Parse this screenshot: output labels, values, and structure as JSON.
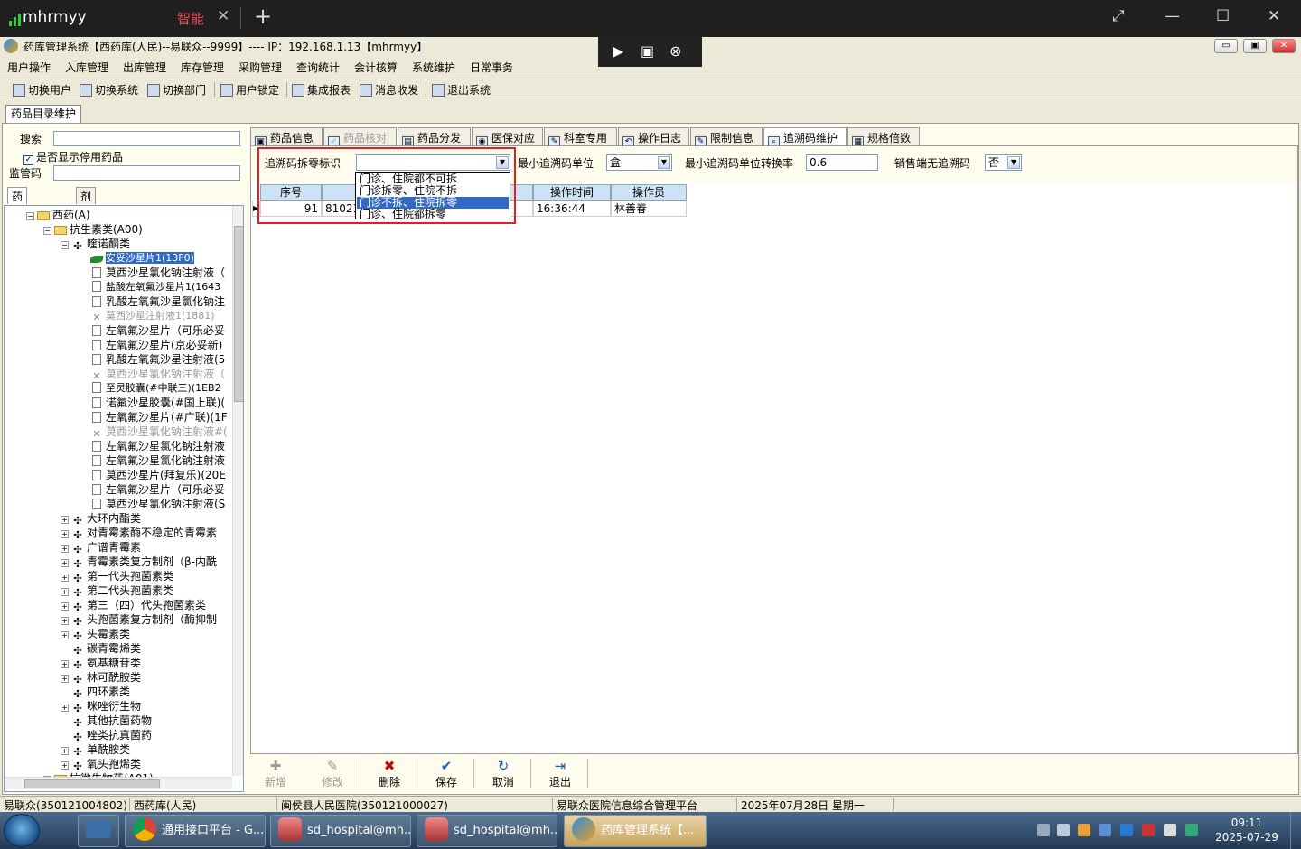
{
  "remote": {
    "brand": "mhrmyy",
    "tab_label": "智能",
    "close_glyph": "✕",
    "plus_glyph": "+",
    "ctrl": [
      "▶",
      "▣",
      "⊗"
    ]
  },
  "window": {
    "title": "药库管理系统【西药库(人民)--易联众--9999】---- IP：192.168.1.13【mhrmyy】",
    "min": "▭",
    "max": "▣",
    "close": "✕"
  },
  "menu": [
    "用户操作",
    "入库管理",
    "出库管理",
    "库存管理",
    "采购管理",
    "查询统计",
    "会计核算",
    "系统维护",
    "日常事务"
  ],
  "toolbar": [
    "切换用户",
    "切换系统",
    "切换部门",
    "用户锁定",
    "集成报表",
    "消息收发",
    "退出系统"
  ],
  "doc_tab": "药品目录维护",
  "left": {
    "search_label": "搜索",
    "show_disabled_label": "是否显示停用药品",
    "show_disabled_check": "✓",
    "supervision_label": "监管码",
    "tabs": [
      "药理结构树",
      "剂型结构树"
    ],
    "tree": [
      {
        "text": "西药(A)",
        "level": 0,
        "exp": "⊟",
        "icon": "folder"
      },
      {
        "text": "抗生素类(A00)",
        "level": 1,
        "exp": "⊟",
        "icon": "folder"
      },
      {
        "text": "喹诺酮类",
        "level": 2,
        "exp": "⊟",
        "icon": "group"
      },
      {
        "text": "安妥沙星片1(13F0)",
        "level": 3,
        "icon": "leaf",
        "selected": true,
        "small": true
      },
      {
        "text": "莫西沙星氯化钠注射液（",
        "level": 3,
        "icon": "file"
      },
      {
        "text": "盐酸左氧氟沙星片1(1643",
        "level": 3,
        "icon": "file",
        "small": true
      },
      {
        "text": "乳酸左氧氟沙星氯化钠注",
        "level": 3,
        "icon": "file"
      },
      {
        "text": "莫西沙星注射液1(1881)",
        "level": 3,
        "icon": "x",
        "disabled": true,
        "small": true
      },
      {
        "text": "左氧氟沙星片（可乐必妥",
        "level": 3,
        "icon": "file"
      },
      {
        "text": "左氧氟沙星片(京必妥新)",
        "level": 3,
        "icon": "file"
      },
      {
        "text": "乳酸左氧氟沙星注射液(5",
        "level": 3,
        "icon": "file"
      },
      {
        "text": "莫西沙星氯化钠注射液（",
        "level": 3,
        "icon": "x",
        "disabled": true
      },
      {
        "text": "至灵胶囊(#中联三)(1EB2",
        "level": 3,
        "icon": "file",
        "small": true
      },
      {
        "text": "诺氟沙星胶囊(#国上联)(",
        "level": 3,
        "icon": "file"
      },
      {
        "text": "左氧氟沙星片(#广联)(1F",
        "level": 3,
        "icon": "file"
      },
      {
        "text": "莫西沙星氯化钠注射液#(",
        "level": 3,
        "icon": "x",
        "disabled": true
      },
      {
        "text": "左氧氟沙星氯化钠注射液",
        "level": 3,
        "icon": "file"
      },
      {
        "text": "左氧氟沙星氯化钠注射液",
        "level": 3,
        "icon": "file"
      },
      {
        "text": "莫西沙星片(拜复乐)(20E",
        "level": 3,
        "icon": "file"
      },
      {
        "text": "左氧氟沙星片（可乐必妥",
        "level": 3,
        "icon": "file"
      },
      {
        "text": "莫西沙星氯化钠注射液(S",
        "level": 3,
        "icon": "file"
      },
      {
        "text": "大环内酯类",
        "level": 2,
        "exp": "⊞",
        "icon": "group"
      },
      {
        "text": "对青霉素酶不稳定的青霉素",
        "level": 2,
        "exp": "⊞",
        "icon": "group"
      },
      {
        "text": "广谱青霉素",
        "level": 2,
        "exp": "⊞",
        "icon": "group"
      },
      {
        "text": "青霉素类复方制剂（β-内酰",
        "level": 2,
        "exp": "⊞",
        "icon": "group"
      },
      {
        "text": "第一代头孢菌素类",
        "level": 2,
        "exp": "⊞",
        "icon": "group"
      },
      {
        "text": "第二代头孢菌素类",
        "level": 2,
        "exp": "⊞",
        "icon": "group"
      },
      {
        "text": "第三（四）代头孢菌素类",
        "level": 2,
        "exp": "⊞",
        "icon": "group"
      },
      {
        "text": "头孢菌素复方制剂（酶抑制",
        "level": 2,
        "exp": "⊞",
        "icon": "group"
      },
      {
        "text": "头霉素类",
        "level": 2,
        "exp": "⊞",
        "icon": "group"
      },
      {
        "text": "碳青霉烯类",
        "level": 2,
        "icon": "group"
      },
      {
        "text": "氨基糖苷类",
        "level": 2,
        "exp": "⊞",
        "icon": "group"
      },
      {
        "text": "林可酰胺类",
        "level": 2,
        "exp": "⊞",
        "icon": "group"
      },
      {
        "text": "四环素类",
        "level": 2,
        "icon": "group"
      },
      {
        "text": "咪唑衍生物",
        "level": 2,
        "exp": "⊞",
        "icon": "group"
      },
      {
        "text": "其他抗菌药物",
        "level": 2,
        "icon": "group"
      },
      {
        "text": "唑类抗真菌药",
        "level": 2,
        "icon": "group"
      },
      {
        "text": "单酰胺类",
        "level": 2,
        "exp": "⊞",
        "icon": "group"
      },
      {
        "text": "氧头孢烯类",
        "level": 2,
        "exp": "⊞",
        "icon": "group"
      },
      {
        "text": "抗微生物药(A01)",
        "level": 1,
        "exp": "⊞",
        "icon": "folder"
      }
    ]
  },
  "right": {
    "tabs": [
      {
        "label": "药品信息",
        "icon": "▣"
      },
      {
        "label": "药品核对",
        "icon": "✓",
        "disabled": true
      },
      {
        "label": "药品分发",
        "icon": "▤"
      },
      {
        "label": "医保对应",
        "icon": "◉"
      },
      {
        "label": "科室专用",
        "icon": "✎"
      },
      {
        "label": "操作日志",
        "icon": "↶"
      },
      {
        "label": "限制信息",
        "icon": "✎"
      },
      {
        "label": "追溯码维护",
        "icon": "⌕",
        "active": true
      },
      {
        "label": "规格倍数",
        "icon": "▦"
      }
    ],
    "filters": {
      "split_label": "追溯码拆零标识",
      "split_value": "",
      "min_unit_label": "最小追溯码单位",
      "min_unit_value": "盒",
      "rate_label": "最小追溯码单位转换率",
      "rate_value": "0.6",
      "no_trace_label": "销售端无追溯码",
      "no_trace_value": "否"
    },
    "dropdown_options": [
      "门诊、住院都不可拆",
      "门诊拆零、住院不拆",
      "门诊不拆、住院拆零",
      "门诊、住院都拆零"
    ],
    "dropdown_highlight": 2,
    "grid": {
      "headers": [
        "序号",
        "",
        "操作时间",
        "操作员"
      ],
      "row": [
        "91",
        "810214",
        "16:36:44",
        "林善春"
      ]
    },
    "actions": [
      {
        "label": "新增",
        "glyph": "✚",
        "disabled": true
      },
      {
        "label": "修改",
        "glyph": "✎",
        "disabled": true
      },
      {
        "label": "删除",
        "glyph": "✖"
      },
      {
        "label": "保存",
        "glyph": "✔"
      },
      {
        "label": "取消",
        "glyph": "↻"
      },
      {
        "label": "退出",
        "glyph": "⇥"
      }
    ]
  },
  "status": [
    "易联众(350121004802)",
    "西药库(人民)",
    "闽侯县人民医院(350121000027)",
    "易联众医院信息综合管理平台",
    "2025年07月28日 星期一"
  ],
  "taskbar": {
    "tasks": [
      "通用接口平台 - G...",
      "sd_hospital@mh...",
      "sd_hospital@mh...",
      "药库管理系统【..."
    ],
    "time": "09:11",
    "date": "2025-07-29"
  },
  "colors": {
    "accent": "#316ac5",
    "alert": "#e02020",
    "panel": "#fefcec"
  }
}
